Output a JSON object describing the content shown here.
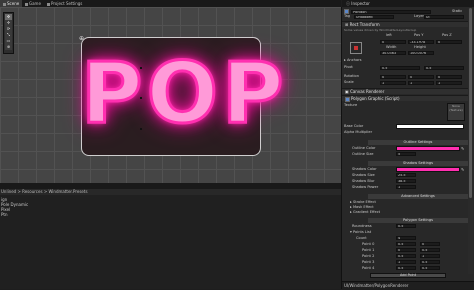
{
  "tabs": [
    {
      "label": "Scene"
    },
    {
      "label": "Game"
    },
    {
      "label": "Project Settings"
    }
  ],
  "scene": {
    "text": "POP",
    "tools": [
      "✥",
      "✢",
      "⟳",
      "⤡",
      "▭",
      "⊕"
    ]
  },
  "project": {
    "path": "Unlined > Resources > Windmatter.Presets",
    "items": [
      "ign",
      "Pole Dynamic",
      "Pixel",
      "Ptn"
    ]
  },
  "inspector": {
    "title": "Inspector",
    "object_name": "Polygon",
    "static_label": "Static",
    "tag_label": "Tag",
    "tag_value": "Untagged",
    "layer_label": "Layer",
    "layer_value": "UI",
    "rect_transform": "Rect Transform",
    "rect_note": "Some values driven by WindmatterLayoutGroup",
    "pos_x_label": "left",
    "pos_y_label": "Pos Y",
    "pos_z_label": "Pos Z",
    "pos_x": "0",
    "pos_y": "-33.1978",
    "pos_z": "0",
    "width_label": "Width",
    "height_label": "Height",
    "width": "30.0363",
    "height": "100.0076",
    "anchors": "Anchors",
    "pivot_label": "Pivot",
    "pivot_x": "0.5",
    "pivot_y": "0.5",
    "rotation_label": "Rotation",
    "rot_x": "0",
    "rot_y": "0",
    "rot_z": "0",
    "scale_label": "Scale",
    "scale_x": "1",
    "scale_y": "1",
    "scale_z": "1",
    "canvas_renderer": "Canvas Renderer",
    "polygon_graphic": "Polygon Graphic (Script)",
    "texture_label": "Texture",
    "texture_slot": "None (Texture)",
    "base_color_label": "Base Color",
    "alpha_label": "Alpha Multiplier",
    "outline_settings": "Outline Settings",
    "outline_color": "Outline Color",
    "outline_size": "Outline Size",
    "outline_size_value": "5",
    "shadow_settings": "Shadow Settings",
    "shadow_color": "Shadow Color",
    "shadow_size": "Shadow Size",
    "shadow_size_value": "25.5",
    "shadow_blur": "Shadow Blur",
    "shadow_blur_value": "38.5",
    "shadow_power": "Shadow Power",
    "shadow_power_value": "1",
    "advanced_settings": "Advanced Settings",
    "stroke_effect": "Stroke Effect",
    "mask_effect": "Mask Effect",
    "gradient_effect": "Gradient Effect",
    "polygon_settings": "Polygon Settings",
    "roundness_label": "Roundness",
    "roundness_value": "0.5",
    "points_list": "Points List",
    "count_label": "Count",
    "count_value": "4",
    "points": [
      {
        "label": "Point 0",
        "x": "0.5",
        "y": "0"
      },
      {
        "label": "Point 1",
        "x": "0",
        "y": "0.5"
      },
      {
        "label": "Point 2",
        "x": "0.5",
        "y": "1"
      },
      {
        "label": "Point 3",
        "x": "1",
        "y": "0.5"
      },
      {
        "label": "Point 4",
        "x": "0.5",
        "y": "0.5"
      }
    ],
    "add_point": "Add Point",
    "footer": "UI/Windmatter/PolygonRenderer"
  },
  "colors": {
    "neon_pink": "#ff2fb0",
    "base_color": "#ffffff",
    "outline_color": "#ff2fb0",
    "shadow_color": "#ff2fb0"
  }
}
